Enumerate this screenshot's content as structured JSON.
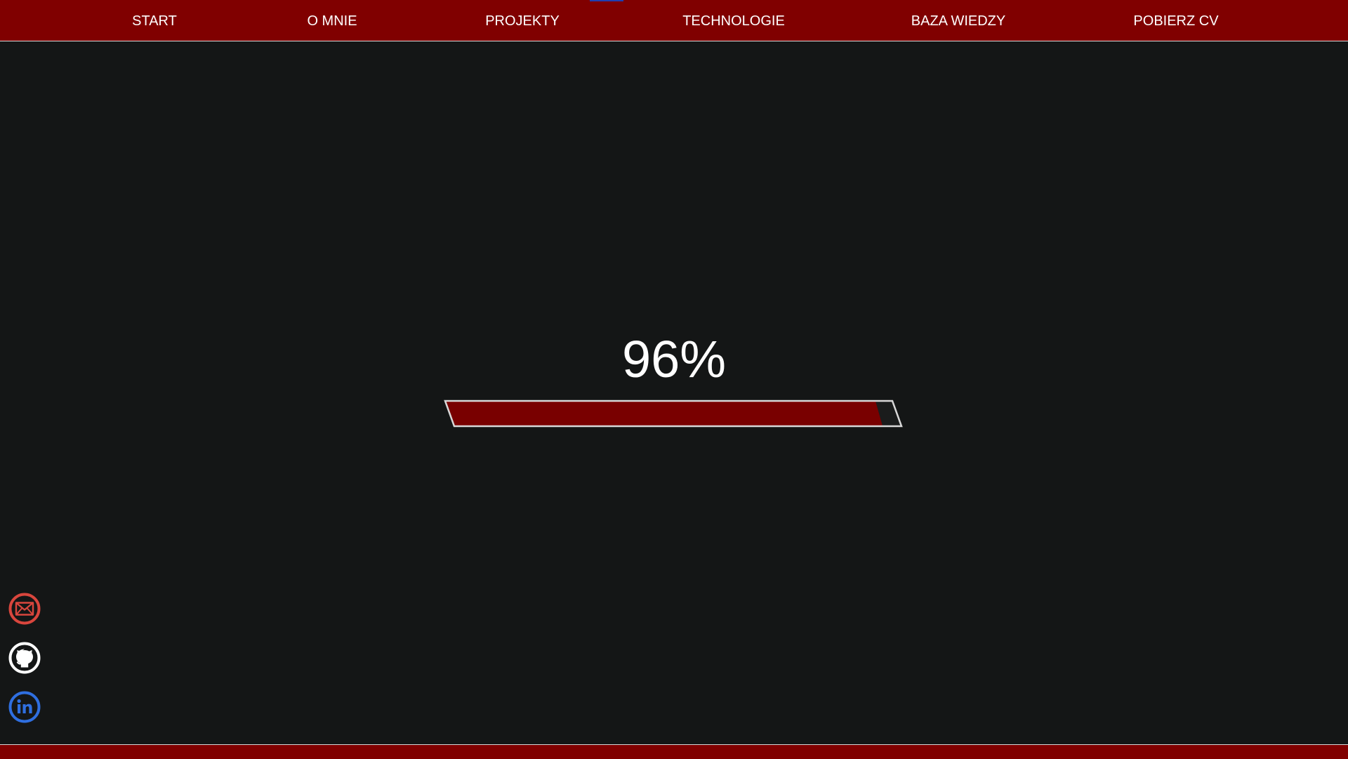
{
  "nav": {
    "items": [
      {
        "label": "START"
      },
      {
        "label": "O MNIE"
      },
      {
        "label": "PROJEKTY"
      },
      {
        "label": "TECHNOLOGIE"
      },
      {
        "label": "BAZA WIEDZY"
      },
      {
        "label": "POBIERZ CV"
      }
    ],
    "indicator_color": "#1f3fb0"
  },
  "loader": {
    "percent_text": "96%",
    "progress": 0.96
  },
  "social": [
    {
      "icon": "mail-icon",
      "color": "#d9463d"
    },
    {
      "icon": "github-icon",
      "color": "#ffffff"
    },
    {
      "icon": "linkedin-icon",
      "color": "#2f6fe0"
    }
  ],
  "colors": {
    "brand": "#800000",
    "background": "#141616",
    "bar_fill": "#790000",
    "bar_border": "#d8d8d8"
  }
}
